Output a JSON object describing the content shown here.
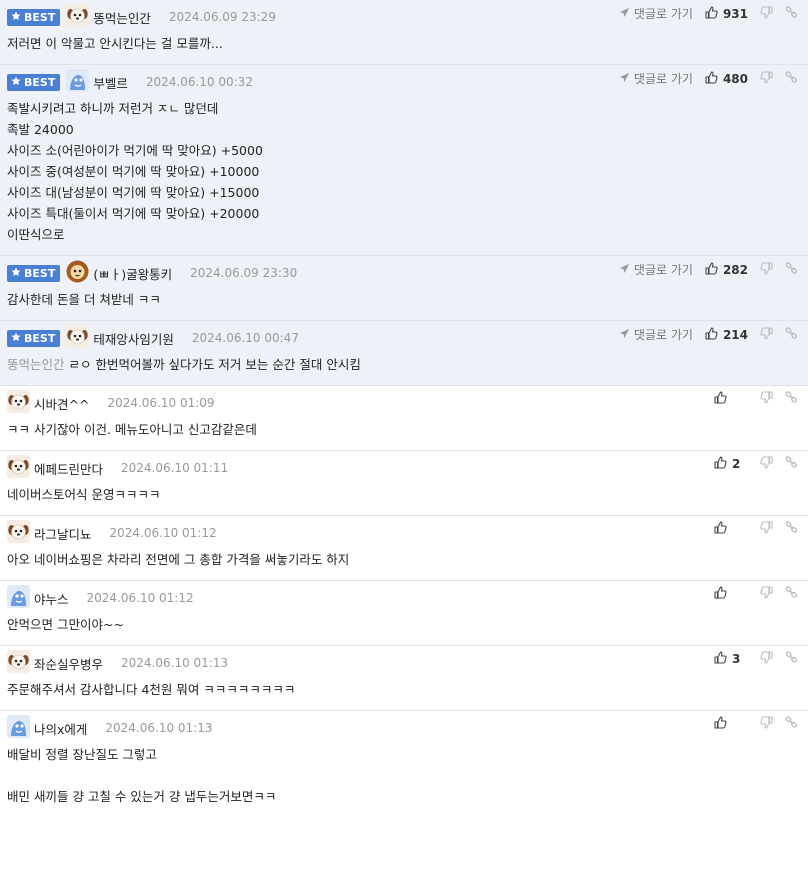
{
  "labels": {
    "best": "BEST",
    "reply": "댓글로 가기"
  },
  "comments": [
    {
      "best": true,
      "avatar": "dog",
      "nick": "똥먹는인간",
      "time": "2024.06.09 23:29",
      "likes": "931",
      "lines": [
        "저러면 이 악물고 안시킨다는 걸 모를까..."
      ]
    },
    {
      "best": true,
      "avatar": "blue",
      "nick": "부벨르",
      "time": "2024.06.10 00:32",
      "likes": "480",
      "lines": [
        "족발시키려고 하니까 저런거 ㅈㄴ 많던데",
        "족발 24000",
        "사이즈 소(어린아이가 먹기에 딱 맞아요) +5000",
        "사이즈 중(여성분이 먹기에 딱 맞아요) +10000",
        "사이즈 대(남성분이 먹기에 딱 맞아요) +15000",
        "사이즈 특대(둘이서 먹기에 딱 맞아요) +20000",
        "이딴식으로"
      ]
    },
    {
      "best": true,
      "avatar": "lion",
      "nick": "(ㅃㅏ)굴왕통키",
      "time": "2024.06.09 23:30",
      "likes": "282",
      "lines": [
        "감사한데 돈을 더 쳐받네 ㅋㅋ"
      ]
    },
    {
      "best": true,
      "avatar": "dog",
      "nick": "테재앙사임기원",
      "time": "2024.06.10 00:47",
      "likes": "214",
      "ref": "똥먹는인간",
      "lines": [
        "ㄹㅇ 한번먹어볼까 싶다가도 저거 보는 순간 절대 안시킴"
      ]
    },
    {
      "best": false,
      "avatar": "dog",
      "nick": "시바견^^",
      "time": "2024.06.10 01:09",
      "likes": "",
      "lines": [
        "ㅋㅋ 사기잖아 이건. 메뉴도아니고 신고감같은데"
      ]
    },
    {
      "best": false,
      "avatar": "dog",
      "nick": "에페드린만다",
      "time": "2024.06.10 01:11",
      "likes": "2",
      "lines": [
        "네이버스토어식 운영ㅋㅋㅋㅋ"
      ]
    },
    {
      "best": false,
      "avatar": "dog",
      "nick": "라그날디뇨",
      "time": "2024.06.10 01:12",
      "likes": "",
      "lines": [
        "아오 네이버쇼핑은 차라리 전면에 그 총합 가격을 써놓기라도 하지"
      ]
    },
    {
      "best": false,
      "avatar": "blue",
      "nick": "야누스",
      "time": "2024.06.10 01:12",
      "likes": "",
      "lines": [
        "안먹으면 그만이야~~"
      ]
    },
    {
      "best": false,
      "avatar": "dog",
      "nick": "좌순실우병우",
      "time": "2024.06.10 01:13",
      "likes": "3",
      "lines": [
        "주문해주셔서 감사합니다 4천원 뭐여 ㅋㅋㅋㅋㅋㅋㅋㅋ"
      ]
    },
    {
      "best": false,
      "avatar": "blue",
      "nick": "나의x에게",
      "time": "2024.06.10 01:13",
      "likes": "",
      "lines": [
        "배달비 정렬 장난질도 그렇고",
        "",
        "배민 새끼들 걍 고칠 수 있는거 걍 냅두는거보면ㅋㅋ"
      ]
    }
  ]
}
